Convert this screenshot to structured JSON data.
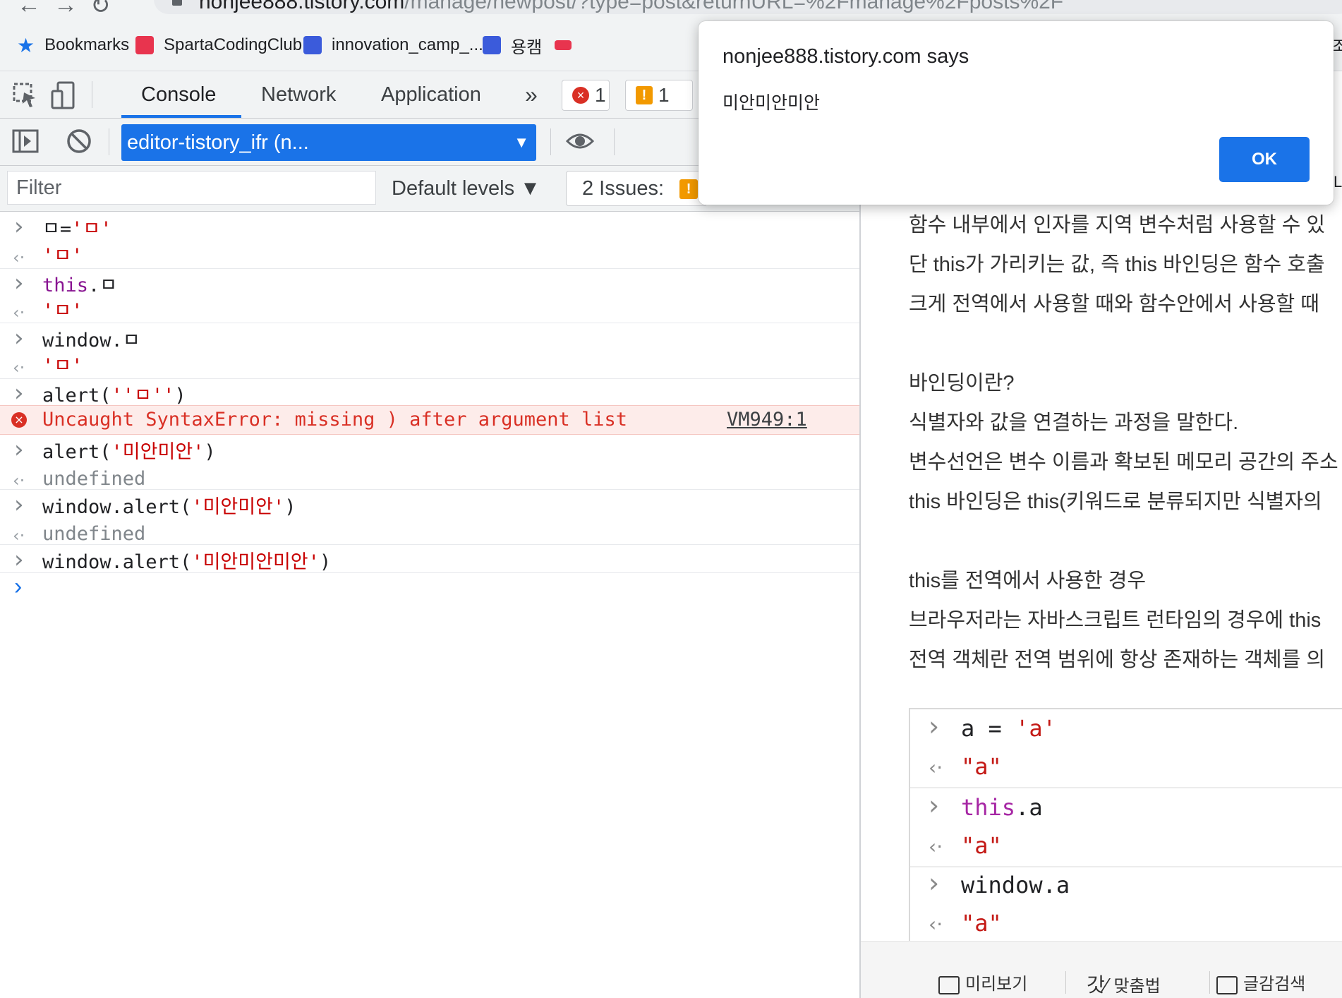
{
  "browser": {
    "url_host": "nonjee888.tistory.com",
    "url_path": "/manage/newpost/?type=post&returnURL=%2Fmanage%2Fposts%2F",
    "bookmarks": [
      {
        "label": "Bookmarks",
        "icon": "star-icon",
        "color": "#1a73e8"
      },
      {
        "label": "SpartaCodingClub",
        "icon": "sparta-logo-icon",
        "color": "#e8344e"
      },
      {
        "label": "innovation_camp_...",
        "icon": "notion-like-icon",
        "color": "#3b5bdb"
      },
      {
        "label": "용캠",
        "icon": "notion-like-icon",
        "color": "#3b5bdb"
      }
    ]
  },
  "devtools": {
    "tabs": [
      "Console",
      "Network",
      "Application"
    ],
    "more_tabs": "»",
    "errors_count": "1",
    "warnings_count": "1",
    "context": "editor-tistory_ifr (n...",
    "filter_placeholder": "Filter",
    "levels": "Default levels ▼",
    "issues": "2 Issues:"
  },
  "console": {
    "lines": [
      {
        "kind": "in",
        "parts": [
          {
            "t": "ㅁ=",
            "c": ""
          },
          {
            "t": "'ㅁ'",
            "c": "str"
          }
        ]
      },
      {
        "kind": "out",
        "parts": [
          {
            "t": "'ㅁ'",
            "c": "str"
          }
        ]
      },
      {
        "kind": "in",
        "parts": [
          {
            "t": "this",
            "c": "kw"
          },
          {
            "t": ".ㅁ",
            "c": ""
          }
        ]
      },
      {
        "kind": "out",
        "parts": [
          {
            "t": "'ㅁ'",
            "c": "str"
          }
        ]
      },
      {
        "kind": "in",
        "parts": [
          {
            "t": "window.ㅁ",
            "c": ""
          }
        ]
      },
      {
        "kind": "out",
        "parts": [
          {
            "t": "'ㅁ'",
            "c": "str"
          }
        ]
      },
      {
        "kind": "in",
        "parts": [
          {
            "t": "alert(",
            "c": ""
          },
          {
            "t": "''ㅁ''",
            "c": "str"
          },
          {
            "t": ")",
            "c": ""
          }
        ]
      },
      {
        "kind": "error",
        "parts": [
          {
            "t": "Uncaught SyntaxError: missing ) after argument list",
            "c": ""
          }
        ],
        "link": "VM949:1"
      },
      {
        "kind": "in",
        "parts": [
          {
            "t": "alert(",
            "c": ""
          },
          {
            "t": "'미안미안'",
            "c": "str"
          },
          {
            "t": ")",
            "c": ""
          }
        ]
      },
      {
        "kind": "out",
        "parts": [
          {
            "t": "undefined",
            "c": "undef"
          }
        ]
      },
      {
        "kind": "in",
        "parts": [
          {
            "t": "window.alert(",
            "c": ""
          },
          {
            "t": "'미안미안'",
            "c": "str"
          },
          {
            "t": ")",
            "c": ""
          }
        ]
      },
      {
        "kind": "out",
        "parts": [
          {
            "t": "undefined",
            "c": "undef"
          }
        ]
      },
      {
        "kind": "in",
        "parts": [
          {
            "t": "window.alert(",
            "c": ""
          },
          {
            "t": "'미안미안미안'",
            "c": "str"
          },
          {
            "t": ")",
            "c": ""
          }
        ]
      }
    ]
  },
  "editor": {
    "paragraphs": [
      "함수 내부에서 인자를 지역 변수처럼 사용할 수 있",
      "단 this가 가리키는 값, 즉 this 바인딩은 함수 호출",
      "크게 전역에서 사용할 때와 함수안에서 사용할 때",
      "",
      "바인딩이란?",
      "식별자와 값을 연결하는 과정을 말한다.",
      "변수선언은 변수 이름과 확보된 메모리 공간의 주소",
      "this 바인딩은 this(키워드로 분류되지만 식별자의",
      "",
      "this를 전역에서 사용한 경우",
      "브라우저라는 자바스크립트 런타임의 경우에 this",
      "전역 객체란 전역 범위에 항상 존재하는 객체를 의"
    ],
    "code_lines": [
      {
        "kind": "in",
        "parts": [
          {
            "t": "a = ",
            "c": ""
          },
          {
            "t": "'a'",
            "c": "str"
          }
        ]
      },
      {
        "kind": "out",
        "parts": [
          {
            "t": "\"a\"",
            "c": "str"
          }
        ]
      },
      {
        "kind": "in",
        "parts": [
          {
            "t": "this",
            "c": "kw"
          },
          {
            "t": ".a",
            "c": ""
          }
        ]
      },
      {
        "kind": "out",
        "parts": [
          {
            "t": "\"a\"",
            "c": "str"
          }
        ]
      },
      {
        "kind": "in",
        "parts": [
          {
            "t": "window.a",
            "c": ""
          }
        ]
      },
      {
        "kind": "out",
        "parts": [
          {
            "t": "\"a\"",
            "c": "str"
          }
        ]
      }
    ],
    "bottom_bar": [
      "미리보기",
      "맞춤법",
      "글감검색"
    ]
  },
  "dialog": {
    "title": "nonjee888.tistory.com says",
    "message": "미안미안미안",
    "ok_label": "OK"
  },
  "edge": {
    "glyph_top": "조",
    "glyph_mid": "L"
  }
}
